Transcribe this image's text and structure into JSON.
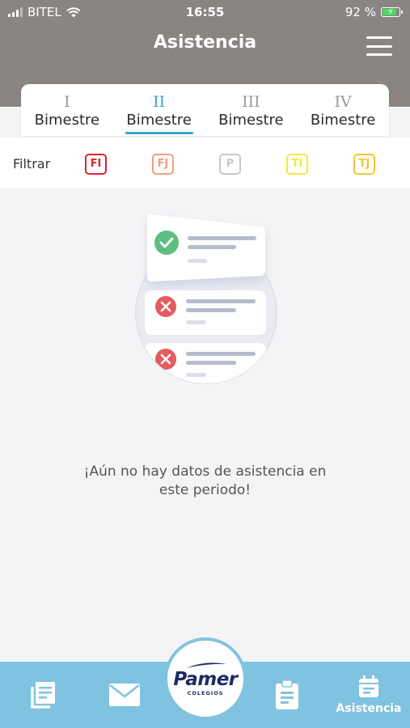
{
  "status_bar": {
    "carrier": "BITEL",
    "time": "16:55",
    "battery": "92 %",
    "battery_level": 0.92
  },
  "header": {
    "title": "Asistencia"
  },
  "tabs": [
    {
      "roman": "I",
      "label": "Bimestre",
      "active": false
    },
    {
      "roman": "II",
      "label": "Bimestre",
      "active": true
    },
    {
      "roman": "III",
      "label": "Bimestre",
      "active": false
    },
    {
      "roman": "IV",
      "label": "Bimestre",
      "active": false
    }
  ],
  "filter": {
    "label": "Filtrar",
    "chips": [
      {
        "code": "FI",
        "color": "#d9262c"
      },
      {
        "code": "FJ",
        "color": "#f2a07b"
      },
      {
        "code": "P",
        "color": "#c9c9c9"
      },
      {
        "code": "TI",
        "color": "#f2ea3a"
      },
      {
        "code": "TJ",
        "color": "#f2c531"
      }
    ]
  },
  "empty_state": {
    "line1": "¡Aún no hay datos de asistencia en",
    "line2": "este periodo!"
  },
  "bottom_nav": {
    "logo_text": "Pamer",
    "logo_subtext": "COLEGIOS",
    "active_label": "Asistencia",
    "icons": [
      "documents-icon",
      "mail-icon",
      "clipboard-icon",
      "calendar-icon"
    ]
  },
  "colors": {
    "header_bg": "#8a8583",
    "accent": "#3aa5c7",
    "nav_bg": "#80c3e0",
    "logo_navy": "#1f2a63"
  }
}
